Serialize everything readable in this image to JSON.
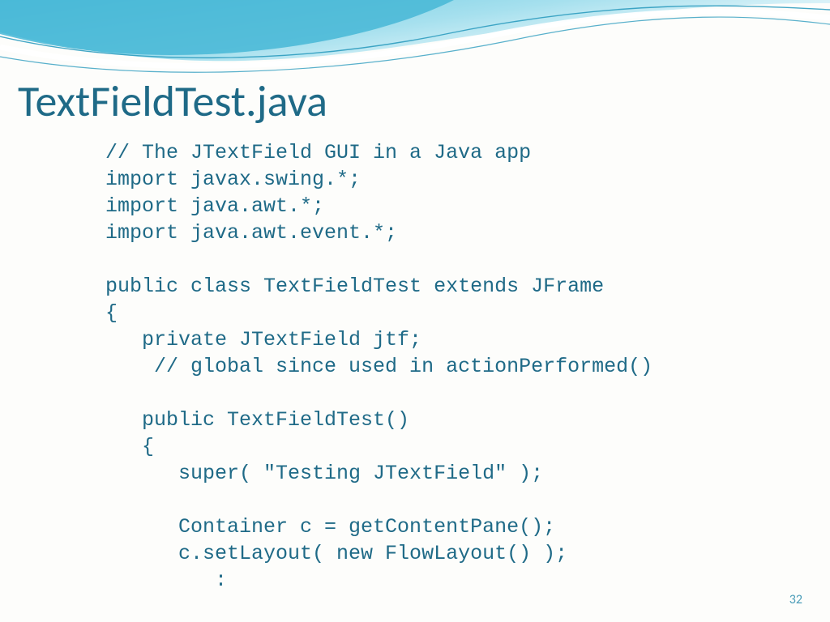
{
  "slide": {
    "title": "TextFieldTest.java",
    "page_number": "32"
  },
  "code": {
    "line1": "// The JTextField GUI in a Java app",
    "line2": "import javax.swing.*;",
    "line3": "import java.awt.*;",
    "line4": "import java.awt.event.*;",
    "line5": "",
    "line6": "public class TextFieldTest extends JFrame",
    "line7": "{",
    "line8": "   private JTextField jtf;",
    "line9": "    // global since used in actionPerformed()",
    "line10": "",
    "line11": "   public TextFieldTest()",
    "line12": "   {",
    "line13": "      super( \"Testing JTextField\" );",
    "line14": "",
    "line15": "      Container c = getContentPane();",
    "line16": "      c.setLayout( new FlowLayout() );",
    "line17": "         :"
  }
}
